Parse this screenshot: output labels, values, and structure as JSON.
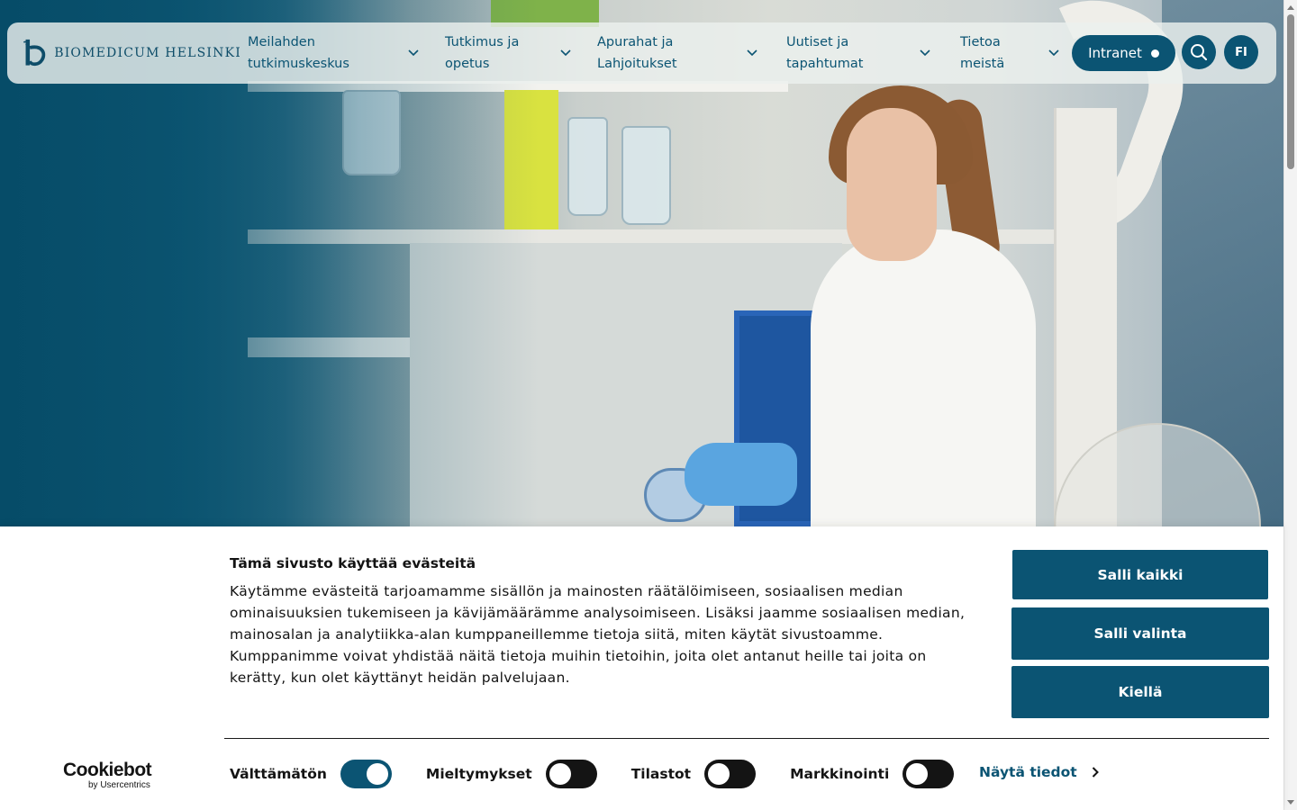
{
  "header": {
    "logo_text": "BIOMEDICUM HELSINKI",
    "nav": [
      {
        "label_line1": "Meilahden",
        "label_line2": "tutkimuskeskus"
      },
      {
        "label_line1": "Tutkimus ja",
        "label_line2": "opetus"
      },
      {
        "label_line1": "Apurahat ja",
        "label_line2": "Lahjoitukset"
      },
      {
        "label_line1": "Uutiset ja",
        "label_line2": "tapahtumat"
      },
      {
        "label_line1": "Tietoa",
        "label_line2": "meistä"
      }
    ],
    "intranet_label": "Intranet",
    "search_icon": "search-icon",
    "language_label": "FI"
  },
  "cookie_banner": {
    "title": "Tämä sivusto käyttää evästeitä",
    "body": "Käytämme evästeitä tarjoamamme sisällön ja mainosten räätälöimiseen, sosiaalisen median ominaisuuksien tukemiseen ja kävijämäärämme analysoimiseen. Lisäksi jaamme sosiaalisen median, mainosalan ja analytiikka-alan kumppaneillemme tietoja siitä, miten käytät sivustoamme. Kumppanimme voivat yhdistää näitä tietoja muihin tietoihin, joita olet antanut heille tai joita on kerätty, kun olet käyttänyt heidän palvelujaan.",
    "buttons": {
      "allow_all": "Salli kaikki",
      "allow_selection": "Salli valinta",
      "deny": "Kiellä"
    },
    "toggles": [
      {
        "label": "Välttämätön",
        "state": "on"
      },
      {
        "label": "Mieltymykset",
        "state": "off"
      },
      {
        "label": "Tilastot",
        "state": "off"
      },
      {
        "label": "Markkinointi",
        "state": "off"
      }
    ],
    "details_link": "Näytä tiedot",
    "brand_word": "Cookiebot",
    "brand_sub": "by Usercentrics"
  },
  "colors": {
    "brand": "#0b5473",
    "text": "#141414",
    "header_bg": "#ecf0ee"
  }
}
